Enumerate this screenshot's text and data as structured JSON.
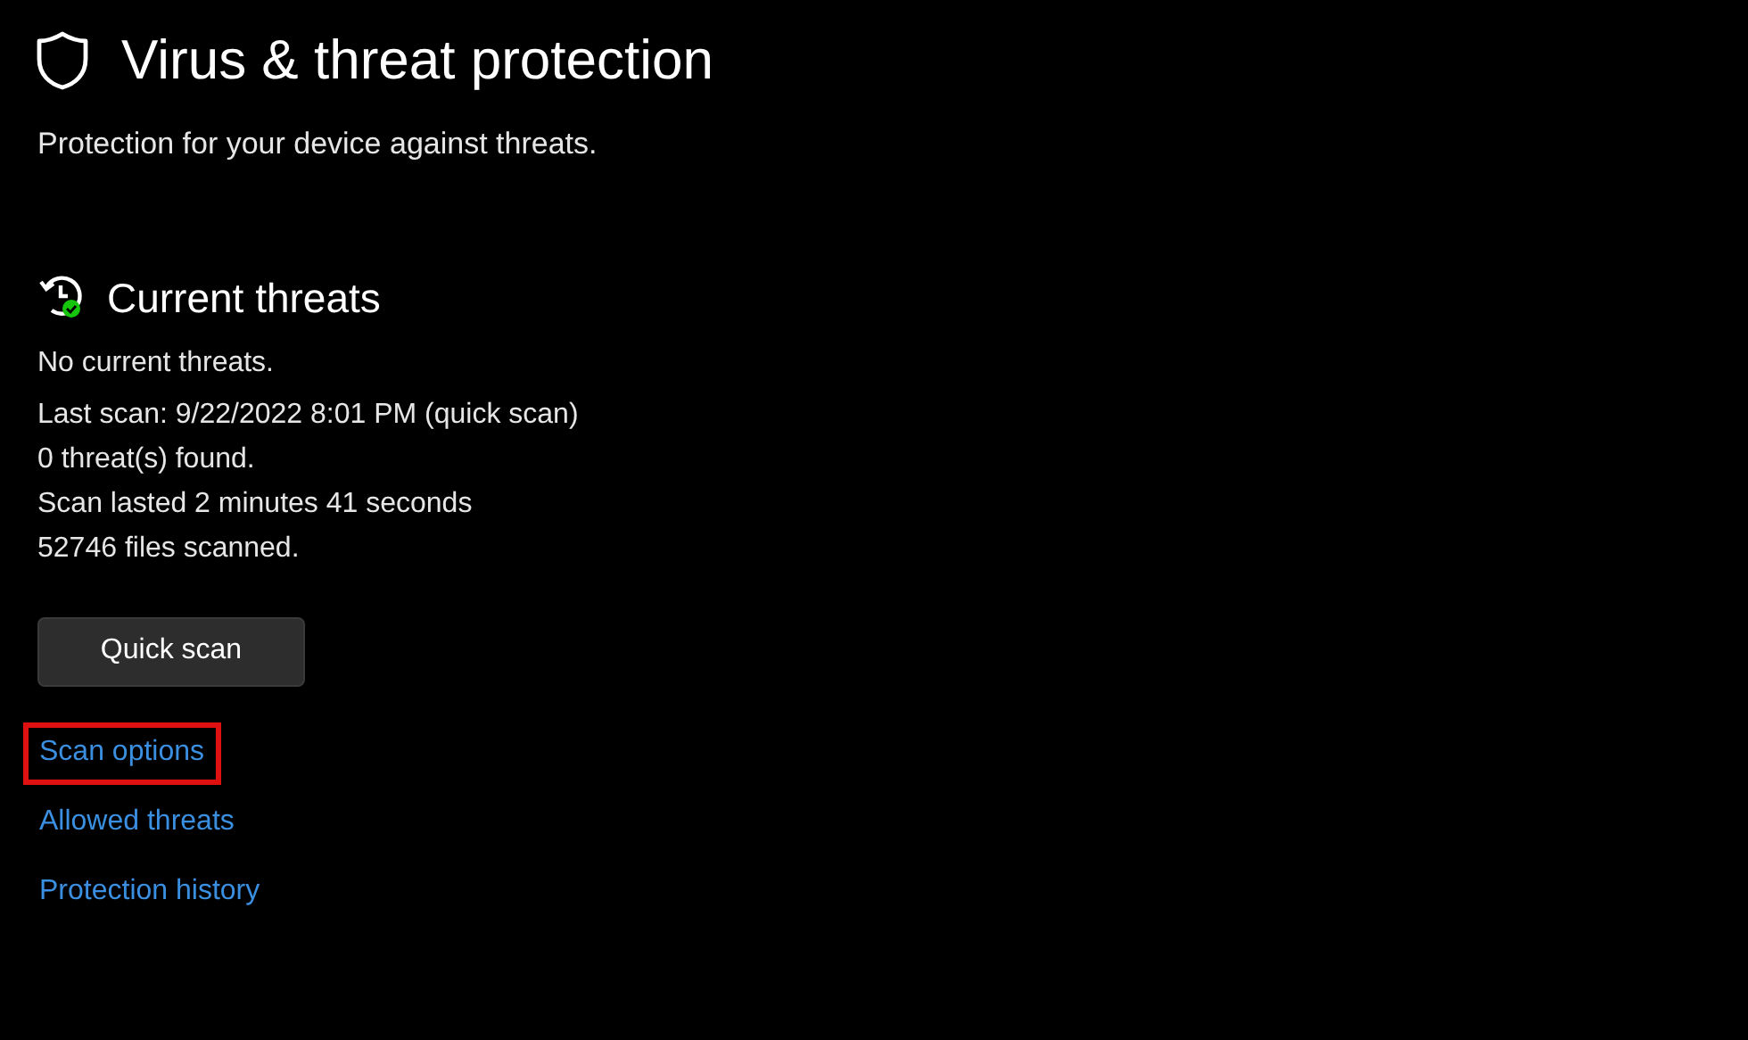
{
  "page": {
    "title": "Virus & threat protection",
    "subtitle": "Protection for your device against threats."
  },
  "current_threats": {
    "heading": "Current threats",
    "status": "No current threats.",
    "details": [
      "Last scan: 9/22/2022 8:01 PM (quick scan)",
      "0 threat(s) found.",
      "Scan lasted 2 minutes 41 seconds",
      "52746 files scanned."
    ],
    "button": "Quick scan"
  },
  "links": [
    {
      "label": "Scan options",
      "highlighted": true
    },
    {
      "label": "Allowed threats",
      "highlighted": false
    },
    {
      "label": "Protection history",
      "highlighted": false
    }
  ]
}
